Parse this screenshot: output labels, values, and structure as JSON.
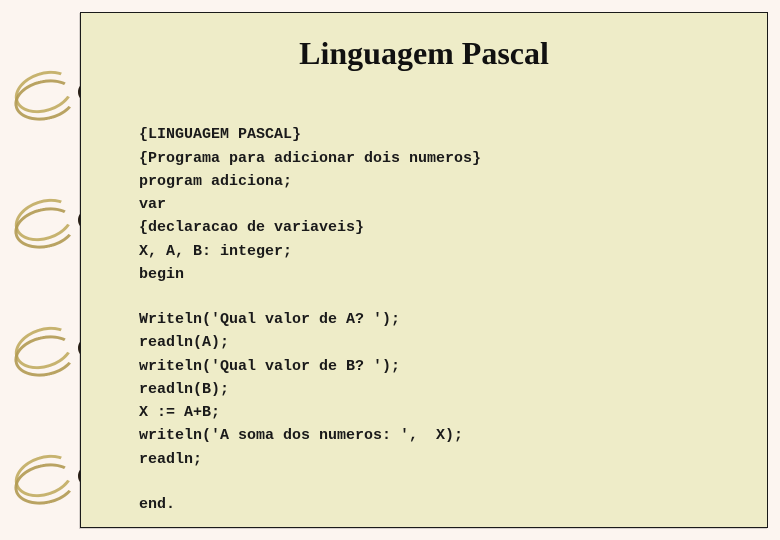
{
  "title": "Linguagem Pascal",
  "code": {
    "block1": [
      "{LINGUAGEM PASCAL}",
      "{Programa para adicionar dois numeros}",
      "program adiciona;",
      "var",
      "{declaracao de variaveis}",
      "X, A, B: integer;",
      "begin"
    ],
    "block2": [
      "Writeln('Qual valor de A? ');",
      "readln(A);",
      "writeln('Qual valor de B? ');",
      "readln(B);",
      "X := A+B;",
      "writeln('A soma dos numeros: ',  X);",
      "readln;"
    ],
    "block3": [
      "end."
    ]
  }
}
